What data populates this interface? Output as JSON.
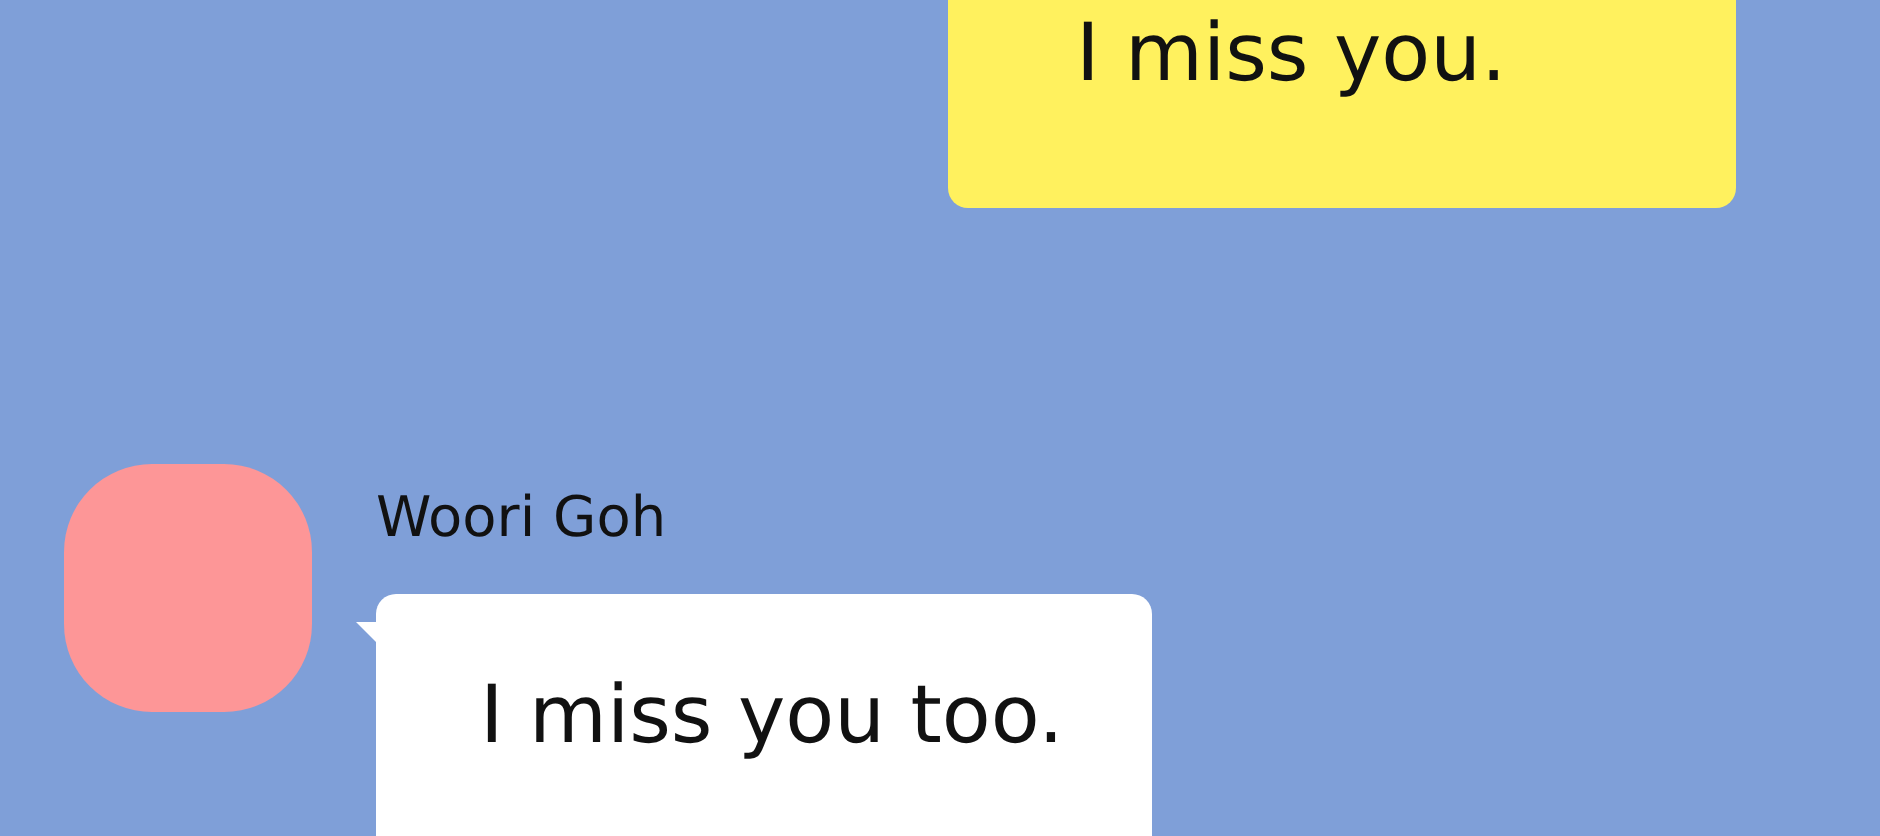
{
  "messages": [
    {
      "kind": "sent",
      "text": "I miss you."
    },
    {
      "kind": "received",
      "sender": "Woori Goh",
      "text": "I miss you too."
    }
  ]
}
